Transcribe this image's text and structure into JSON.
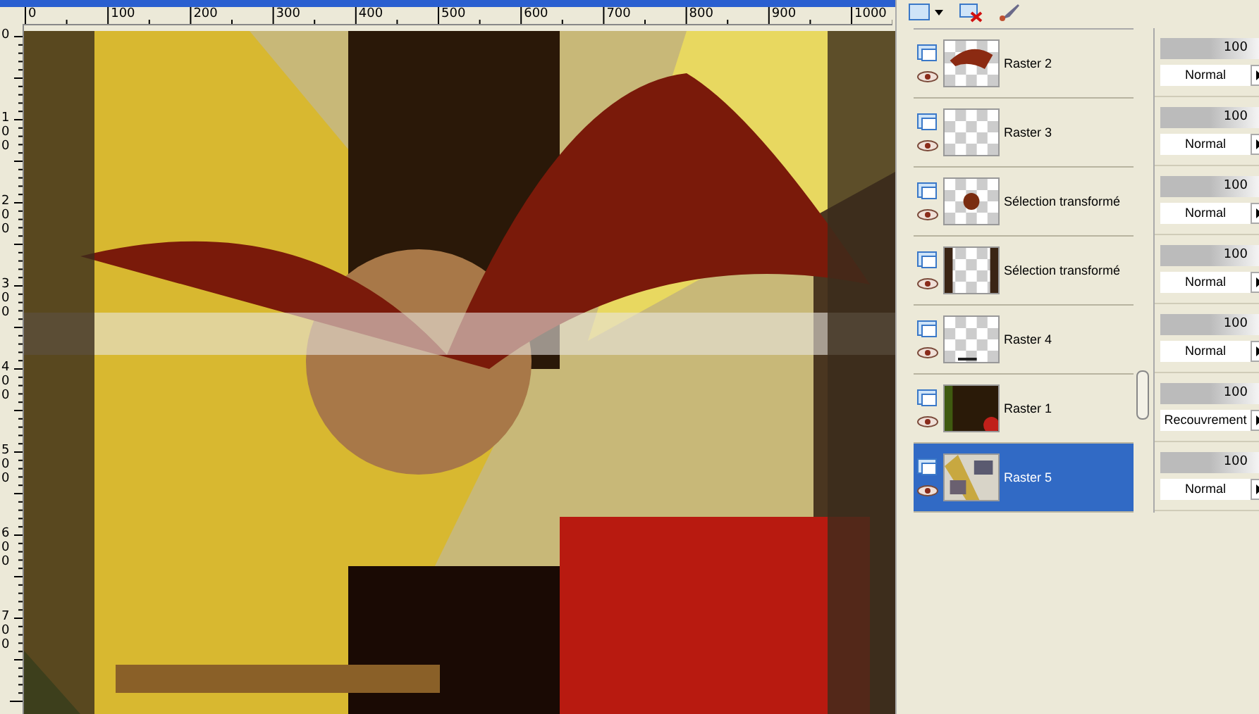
{
  "ruler_top": {
    "labels": [
      "0",
      "100",
      "200",
      "300",
      "400",
      "500",
      "600",
      "700",
      "800",
      "900",
      "1000"
    ]
  },
  "ruler_left": {
    "labels": [
      "0",
      "100",
      "200",
      "300",
      "400",
      "500",
      "600",
      "700"
    ]
  },
  "layers": [
    {
      "name": "Raster 2",
      "visible": true,
      "selected": false,
      "opacity": "100",
      "level": 1,
      "blend": "Normal"
    },
    {
      "name": "Raster 3",
      "visible": true,
      "selected": false,
      "opacity": "100",
      "level": 1,
      "blend": "Normal"
    },
    {
      "name": "Sélection transformé",
      "visible": true,
      "selected": false,
      "opacity": "100",
      "level": 1,
      "blend": "Normal"
    },
    {
      "name": "Sélection transformé",
      "visible": true,
      "selected": false,
      "opacity": "100",
      "level": 1,
      "blend": "Normal"
    },
    {
      "name": "Raster 4",
      "visible": true,
      "selected": false,
      "opacity": "100",
      "level": 1,
      "blend": "Normal"
    },
    {
      "name": "Raster 1",
      "visible": true,
      "selected": false,
      "opacity": "100",
      "level": 1,
      "blend": "Recouvrement"
    },
    {
      "name": "Raster 5",
      "visible": true,
      "selected": true,
      "opacity": "100",
      "level": 1,
      "blend": "Normal"
    }
  ]
}
